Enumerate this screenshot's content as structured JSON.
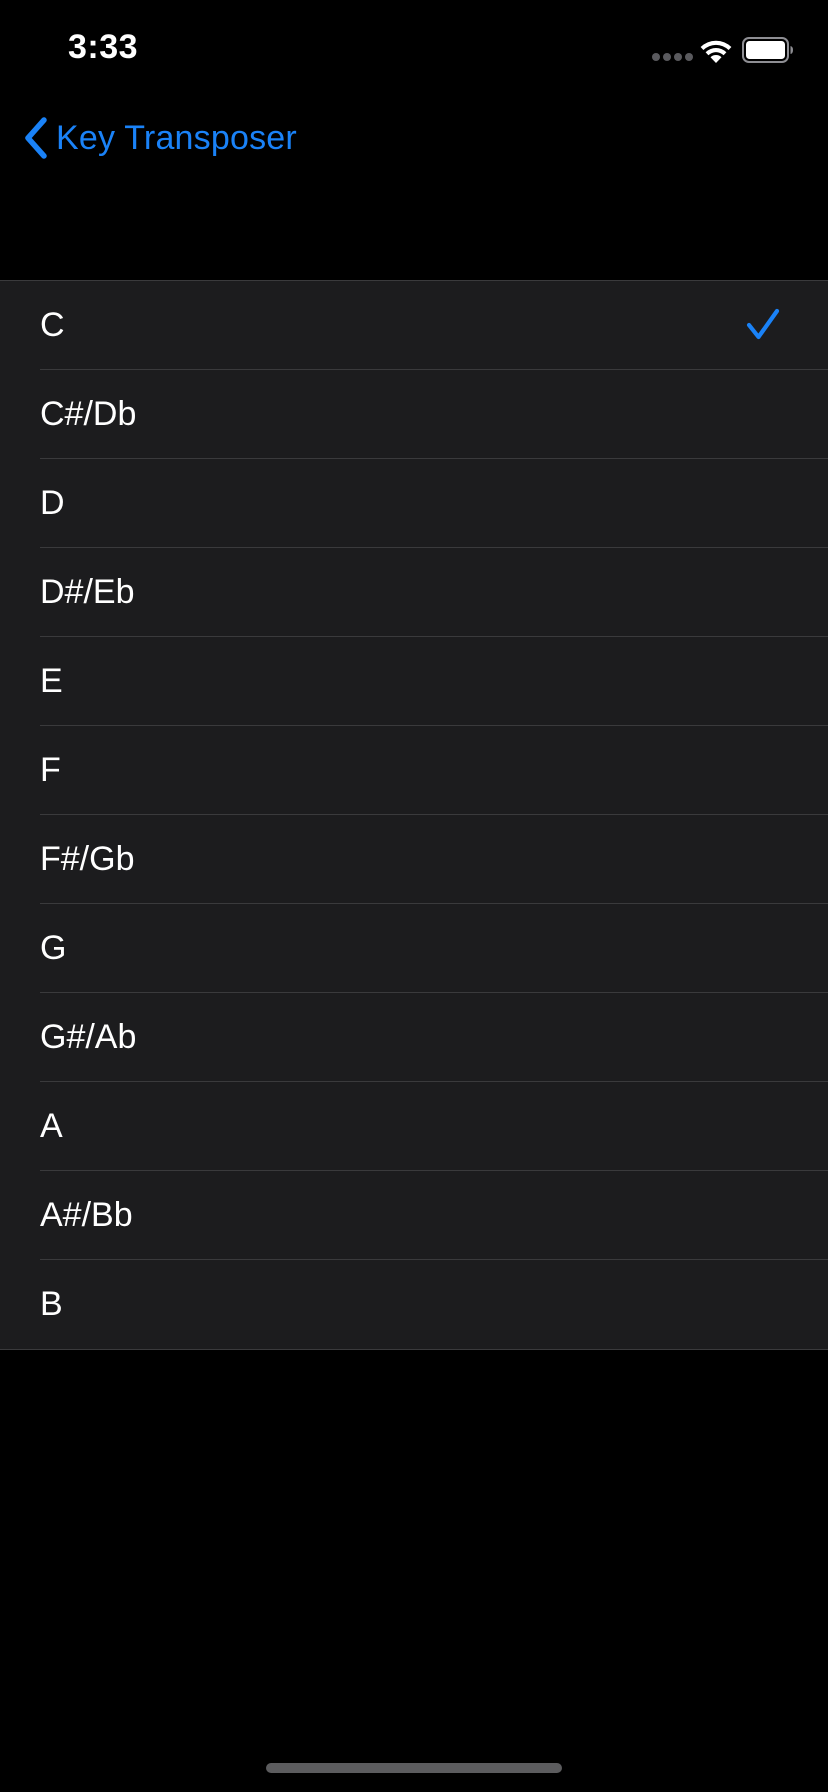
{
  "status_bar": {
    "time": "3:33",
    "signal_icon": "cellular-signal-icon",
    "wifi_icon": "wifi-icon",
    "battery_icon": "battery-icon"
  },
  "nav": {
    "back_label": "Key Transposer",
    "back_icon": "chevron-left-icon"
  },
  "list": {
    "selected": "C",
    "check_icon": "checkmark-icon",
    "items": [
      {
        "label": "C",
        "selected": true
      },
      {
        "label": "C#/Db",
        "selected": false
      },
      {
        "label": "D",
        "selected": false
      },
      {
        "label": "D#/Eb",
        "selected": false
      },
      {
        "label": "E",
        "selected": false
      },
      {
        "label": "F",
        "selected": false
      },
      {
        "label": "F#/Gb",
        "selected": false
      },
      {
        "label": "G",
        "selected": false
      },
      {
        "label": "G#/Ab",
        "selected": false
      },
      {
        "label": "A",
        "selected": false
      },
      {
        "label": "A#/Bb",
        "selected": false
      },
      {
        "label": "B",
        "selected": false
      }
    ]
  },
  "colors": {
    "accent": "#1a82f7",
    "background": "#000000",
    "cell_background": "#1c1c1e",
    "separator": "#3a3a3c",
    "text": "#ffffff"
  }
}
